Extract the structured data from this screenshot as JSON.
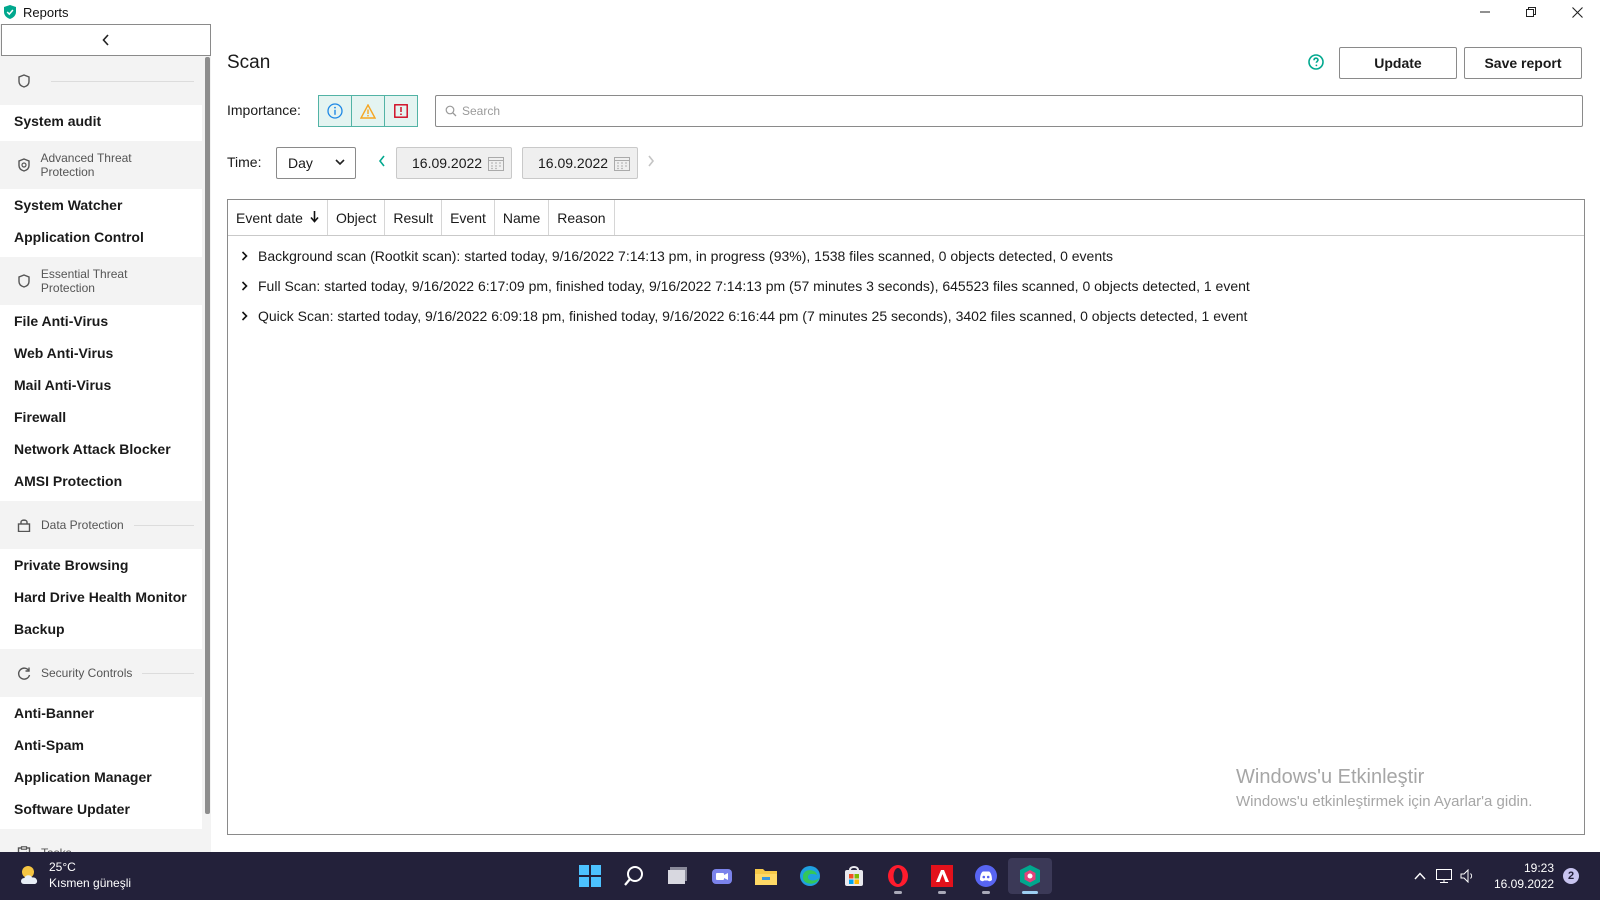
{
  "window": {
    "title": "Reports"
  },
  "sidebar": {
    "groups": [
      {
        "header": "",
        "header_icon": "shield-outline-icon",
        "items": [
          "System audit"
        ]
      },
      {
        "header": "Advanced Threat Protection",
        "header_icon": "shield-gear-icon",
        "items": [
          "System Watcher",
          "Application Control"
        ]
      },
      {
        "header": "Essential Threat Protection",
        "header_icon": "shield-icon",
        "items": [
          "File Anti-Virus",
          "Web Anti-Virus",
          "Mail Anti-Virus",
          "Firewall",
          "Network Attack Blocker",
          "AMSI Protection"
        ]
      },
      {
        "header": "Data Protection",
        "header_icon": "lock-icon",
        "items": [
          "Private Browsing",
          "Hard Drive Health Monitor",
          "Backup"
        ]
      },
      {
        "header": "Security Controls",
        "header_icon": "shield-check-icon",
        "items": [
          "Anti-Banner",
          "Anti-Spam",
          "Application Manager",
          "Software Updater"
        ]
      },
      {
        "header": "Tasks",
        "header_icon": "clipboard-check-icon",
        "items": []
      }
    ]
  },
  "main": {
    "title": "Scan",
    "buttons": {
      "update": "Update",
      "save_report": "Save report"
    },
    "importance_label": "Importance:",
    "search_placeholder": "Search",
    "time_label": "Time:",
    "period": "Day",
    "date_from": "16.09.2022",
    "date_to": "16.09.2022",
    "columns": [
      "Event date",
      "Object",
      "Result",
      "Event",
      "Name",
      "Reason"
    ],
    "rows": [
      "Background scan (Rootkit scan): started today, 9/16/2022 7:14:13 pm, in progress (93%), 1538 files scanned, 0 objects detected, 0 events",
      "Full Scan: started today, 9/16/2022 6:17:09 pm, finished today, 9/16/2022 7:14:13 pm (57 minutes 3 seconds), 645523 files scanned, 0 objects detected, 1 event",
      "Quick Scan: started today, 9/16/2022 6:09:18 pm, finished today, 9/16/2022 6:16:44 pm (7 minutes 25 seconds), 3402 files scanned, 0 objects detected, 1 event"
    ]
  },
  "watermark": {
    "title": "Windows'u Etkinleştir",
    "subtitle": "Windows'u etkinleştirmek için Ayarlar'a gidin."
  },
  "taskbar": {
    "weather_temp": "25°C",
    "weather_desc": "Kısmen güneşli",
    "apps": [
      "start-icon",
      "search-icon",
      "task-view-icon",
      "teams-chat-icon",
      "file-explorer-icon",
      "edge-icon",
      "store-icon",
      "opera-icon",
      "amd-icon",
      "discord-icon",
      "kaspersky-icon"
    ],
    "time": "19:23",
    "date": "16.09.2022",
    "notifications": "2"
  },
  "colors": {
    "accent": "#00a88e",
    "taskbar": "#23213a",
    "info": "#1e88e5",
    "warning": "#f5a623",
    "critical": "#d0021b"
  }
}
